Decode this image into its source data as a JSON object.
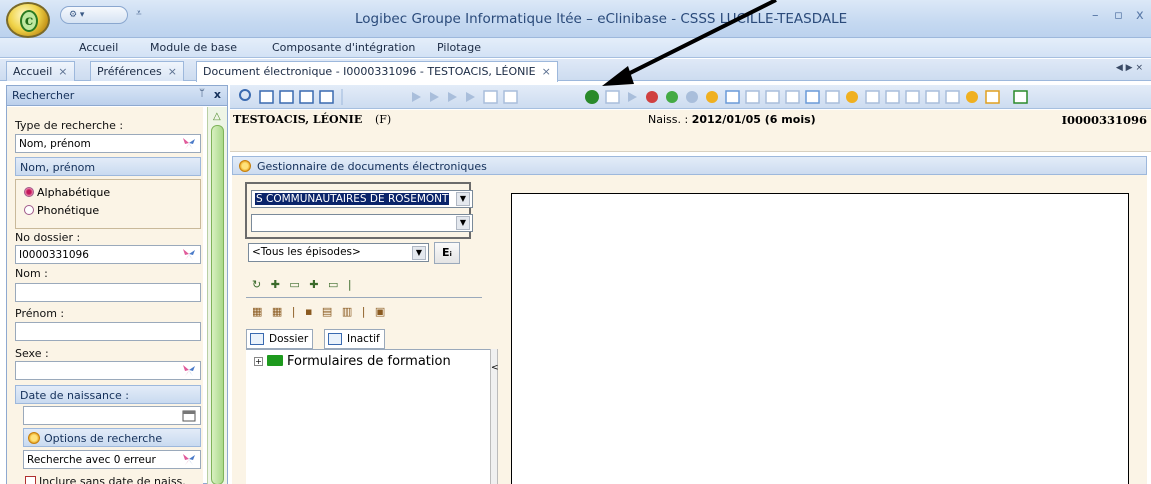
{
  "window": {
    "title": "Logibec Groupe Informatique ltée – eClinibase - CSSS LUCILLE-TEASDALE",
    "minimize": "–",
    "restore": "▫",
    "close": "x"
  },
  "menu": [
    "Accueil",
    "Module de base",
    "Composante d'intégration",
    "Pilotage"
  ],
  "tabs": [
    {
      "label": "Accueil"
    },
    {
      "label": "Préférences"
    },
    {
      "label": "Document électronique - I0000331096 - TESTOACIS, LÉONIE"
    }
  ],
  "tab_close": "×",
  "tab_scroll": "◀  ▶  ×",
  "search_panel": {
    "title": "Rechercher",
    "pin": "ᛘ",
    "close": "x",
    "type_label": "Type de recherche :",
    "type_value": "Nom, prénom",
    "section_title": "Nom, prénom",
    "radio_alpha": "Alphabétique",
    "radio_phon": "Phonétique",
    "dossier_label": "No dossier :",
    "dossier_value": "I0000331096",
    "nom_label": "Nom :",
    "prenom_label": "Prénom :",
    "sexe_label": "Sexe :",
    "dob_section": "Date de naissance :",
    "options_section": "Options de recherche",
    "search_mode": "Recherche avec 0 erreur",
    "include_label": "Inclure sans date de naiss."
  },
  "patient": {
    "name": "TESTOACIS, LÉONIE",
    "sex": "(F)",
    "naiss_label": "Naiss. :",
    "naiss_value": "2012/01/05 (6 mois)",
    "id": "I0000331096"
  },
  "gde": {
    "title": "Gestionnaire de documents électroniques",
    "combo1": "S COMMUNAUTAIRES DE ROSEMONT",
    "combo2": "",
    "episodes": "<Tous les épisodes>",
    "ep_button": "Eᵢ",
    "subtab_dossier": "Dossier",
    "subtab_inactif": "Inactif",
    "tree_item": "Formulaires de formation",
    "tree_expander": "+",
    "scroll_glyph": "<"
  },
  "icons": {
    "combo_arrow": "▼",
    "small_tb1": "↻ ✚ ▭ ✚ ▭ |",
    "small_tb2": "▦ ▦ | ▪ ▤ ▥ | ▣"
  },
  "colors": {
    "title_text": "#2a4a7a",
    "panel_bg": "#fbf4e6",
    "selection": "#0a246a",
    "accent_green": "#1e9a1e"
  }
}
